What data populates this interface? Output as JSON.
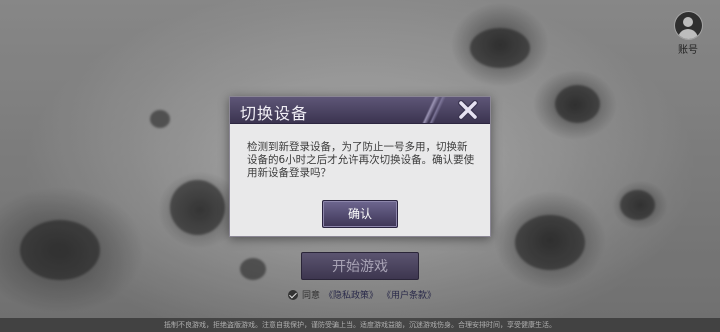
{
  "account": {
    "label": "账号",
    "icon": "user-avatar-icon"
  },
  "main": {
    "start_button": "开始游戏",
    "agree_prefix": "同意",
    "privacy_link": "《隐私政策》",
    "terms_link": "《用户条款》",
    "check_icon": "checkmark-icon"
  },
  "footer": {
    "notice": "抵制不良游戏，拒绝盗版游戏。注意自我保护，谨防受骗上当。适度游戏益脑，沉迷游戏伤身。合理安排时间，享受健康生活。"
  },
  "dialog": {
    "title": "切换设备",
    "close_icon": "close-x-icon",
    "message": "检测到新登录设备，为了防止一号多用，切换新设备的6小时之后才允许再次切换设备。确认要使用新设备登录吗？",
    "confirm_label": "确认"
  },
  "colors": {
    "header_purple": "#4a4363",
    "button_purple": "#5b5470",
    "dialog_bg": "#e9e9ea"
  }
}
